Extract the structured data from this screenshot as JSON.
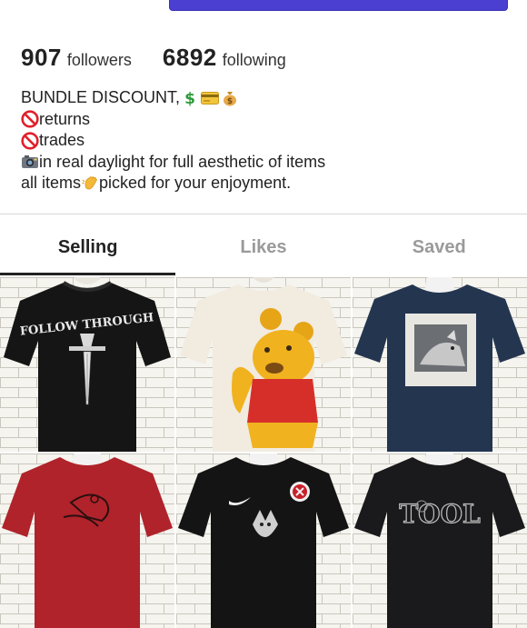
{
  "stats": {
    "followers_count": "907",
    "followers_label": "followers",
    "following_count": "6892",
    "following_label": "following"
  },
  "bio": {
    "line1": "BUNDLE DISCOUNT, ",
    "line2": "returns",
    "line3": "trades",
    "line4": " in real daylight for full aesthetic of items",
    "line5a": "all items ",
    "line5b": "picked for your enjoyment."
  },
  "icons": {
    "line1": [
      "dollar-icon",
      "credit-card-icon",
      "money-bag-icon"
    ],
    "line2": "prohibited-icon",
    "line3": "prohibited-icon",
    "line4": "camera-icon",
    "line5": "waving-hand-icon"
  },
  "tabs": [
    {
      "label": "Selling",
      "active": true
    },
    {
      "label": "Likes",
      "active": false
    },
    {
      "label": "Saved",
      "active": false
    }
  ],
  "listings": [
    {
      "item": "black-shirt-dagger-graphic",
      "shirt_color": "#151515",
      "graphic_text": "FOLLOW THROUGH"
    },
    {
      "item": "cream-shirt-winnie-the-pooh",
      "shirt_color": "#f1ebe0"
    },
    {
      "item": "navy-shirt-wolf-square",
      "shirt_color": "#243550"
    },
    {
      "item": "red-shirt-graphic",
      "shirt_color": "#b0232a"
    },
    {
      "item": "black-shirt-nike-cat",
      "shirt_color": "#141414"
    },
    {
      "item": "black-shirt-tool",
      "shirt_color": "#1a1a1c",
      "graphic_text": "TOOL"
    }
  ],
  "colors": {
    "accent": "#4a3fd1",
    "tab_active": "#222222",
    "tab_inactive": "#9a9a9a",
    "prohibited": "#e0202a"
  }
}
